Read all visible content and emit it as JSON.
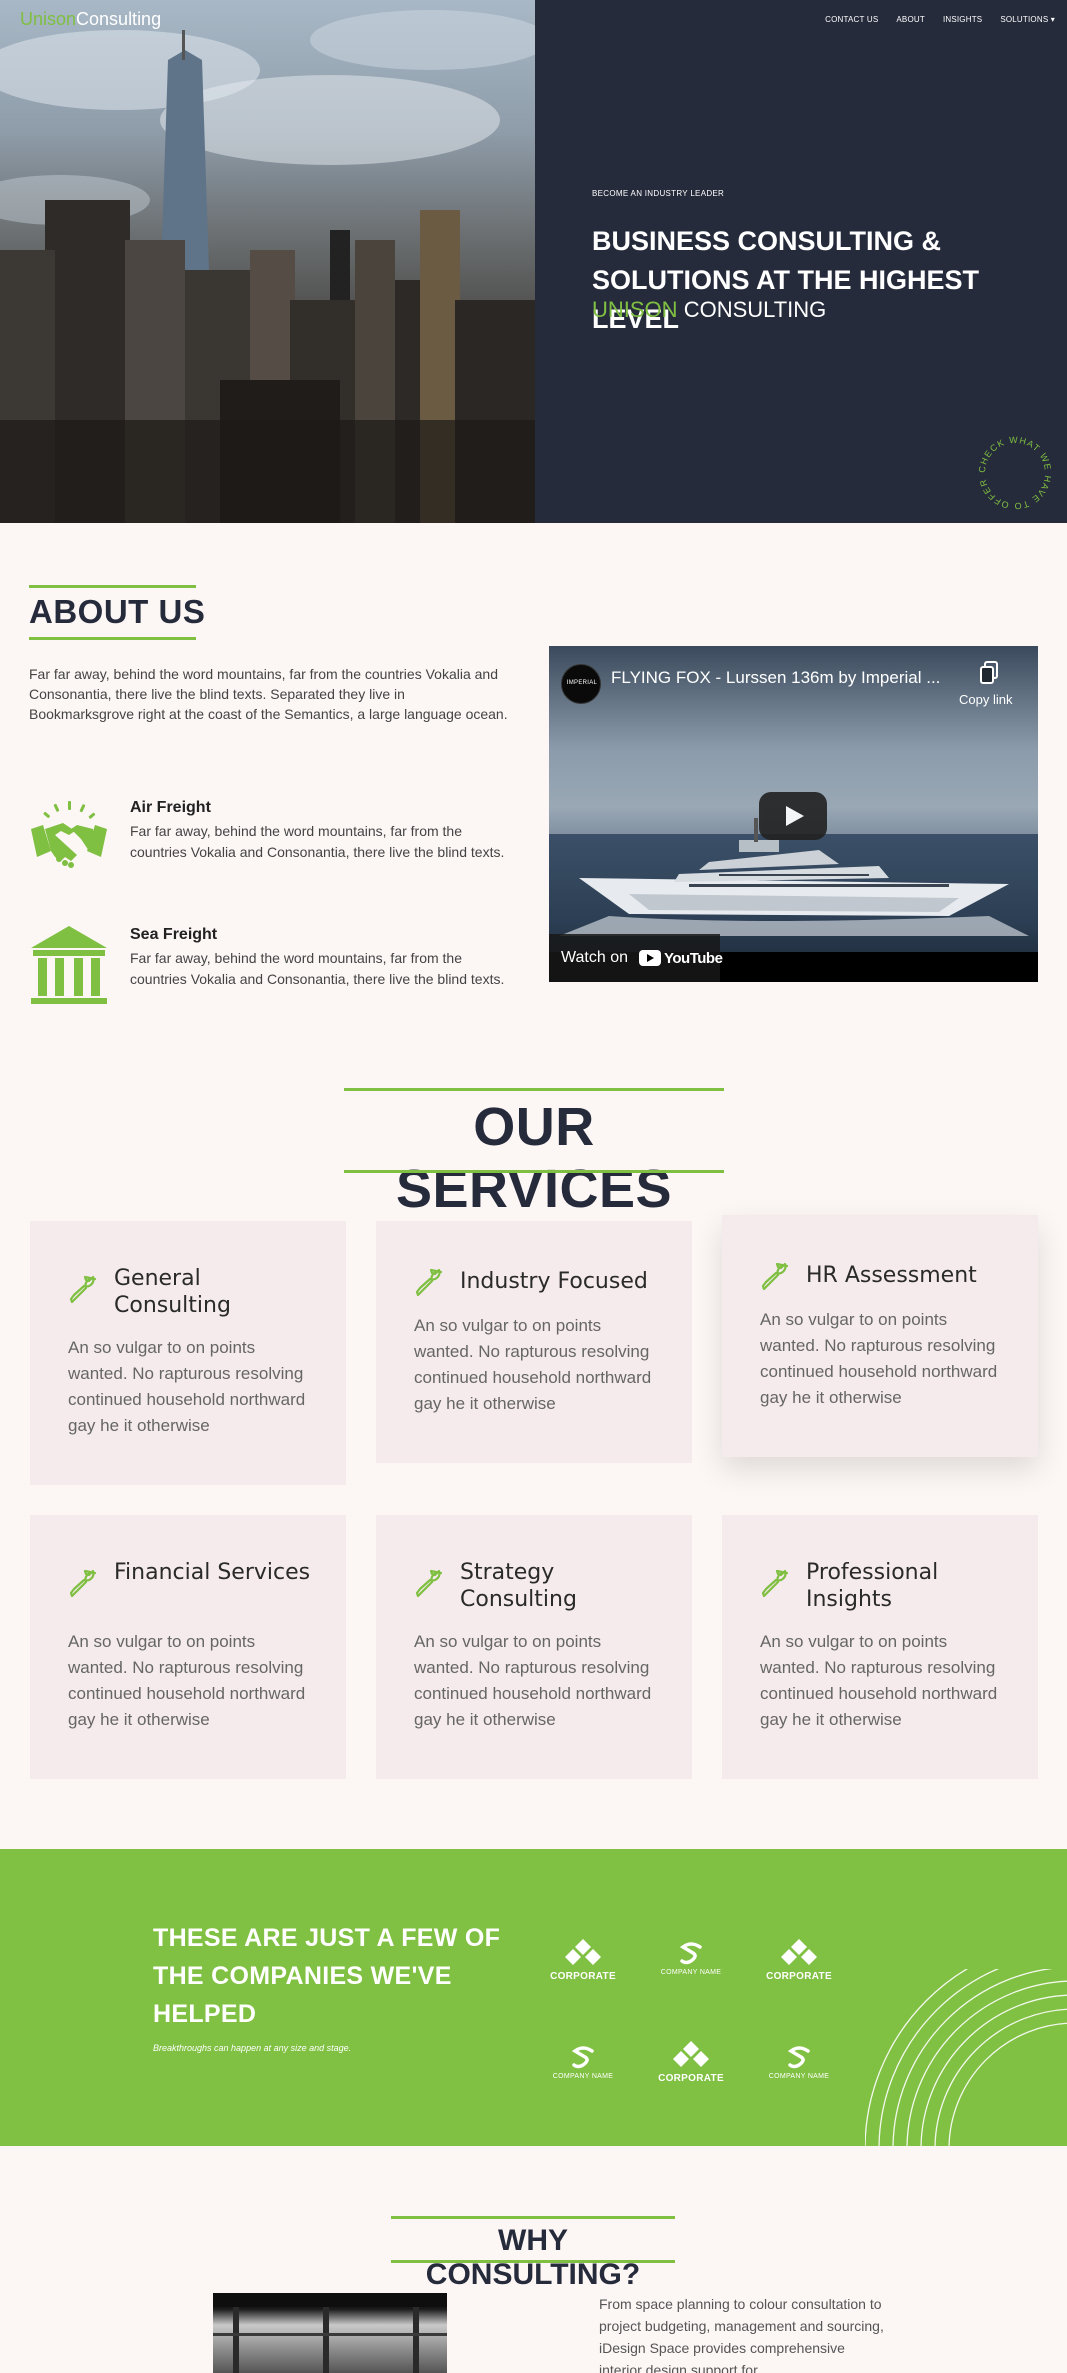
{
  "brand": {
    "first": "Unison",
    "second": "Consulting",
    "accent_color": "#7fbf41",
    "dark_color": "#262b3b"
  },
  "nav": [
    {
      "label": "CONTACT US"
    },
    {
      "label": "ABOUT"
    },
    {
      "label": "INSIGHTS"
    },
    {
      "label": "SOLUTIONS ▾"
    }
  ],
  "hero": {
    "kicker": "BECOME AN INDUSTRY LEADER",
    "title": "BUSINESS CONSULTING & SOLUTIONS AT THE HIGHEST LEVEL",
    "sub_green": "UNISON",
    "sub_white": "CONSULTING",
    "circle_text": "CHECK WHAT WE HAVE TO OFFER · "
  },
  "about": {
    "title": "ABOUT US",
    "text": "Far far away, behind the word mountains, far from the countries Vokalia and Consonantia, there live the blind texts. Separated they live in Bookmarksgrove right at the coast of the Semantics, a large language ocean.",
    "features": [
      {
        "icon": "handshake-icon",
        "title": "Air Freight",
        "text": "Far far away, behind the word mountains, far from the countries Vokalia and Consonantia, there live the blind texts."
      },
      {
        "icon": "bank-icon",
        "title": "Sea Freight",
        "text": "Far far away, behind the word mountains, far from the countries Vokalia and Consonantia, there live the blind texts."
      }
    ]
  },
  "video": {
    "title": "FLYING FOX - Lurssen 136m by Imperial ...",
    "channel": "IMPERIAL",
    "copy_label": "Copy link",
    "watch_label": "Watch on",
    "youtube_label": "YouTube"
  },
  "services": {
    "title": "OUR SERVICES",
    "cards": [
      {
        "title": "General Consulting",
        "text": "An so vulgar to on points wanted. No rapturous resolving continued household northward gay he it otherwise"
      },
      {
        "title": "Industry Focused",
        "text": "An so vulgar to on points wanted. No rapturous resolving continued household northward gay he it otherwise"
      },
      {
        "title": "HR Assessment",
        "text": "An so vulgar to on points wanted. No rapturous resolving continued household northward gay he it otherwise"
      },
      {
        "title": "Financial Services",
        "text": "An so vulgar to on points wanted. No rapturous resolving continued household northward gay he it otherwise"
      },
      {
        "title": "Strategy Consulting",
        "text": "An so vulgar to on points wanted. No rapturous resolving continued household northward gay he it otherwise"
      },
      {
        "title": "Professional Insights",
        "text": "An so vulgar to on points wanted. No rapturous resolving continued household northward gay he it otherwise"
      }
    ]
  },
  "companies": {
    "title": "THESE ARE JUST A FEW OF THE COMPANIES WE'VE HELPED",
    "subtitle": "Breakthroughs can happen at any size and stage.",
    "logos": [
      {
        "label": "CORPORATE"
      },
      {
        "label": "COMPANY NAME"
      },
      {
        "label": "CORPORATE"
      },
      {
        "label": "COMPANY NAME"
      },
      {
        "label": "CORPORATE"
      },
      {
        "label": "COMPANY NAME"
      }
    ]
  },
  "why": {
    "title": "WHY CONSULTING?",
    "text": "From space planning to colour consultation to project budgeting, management and sourcing, iDesign Space provides comprehensive interior design support for"
  }
}
